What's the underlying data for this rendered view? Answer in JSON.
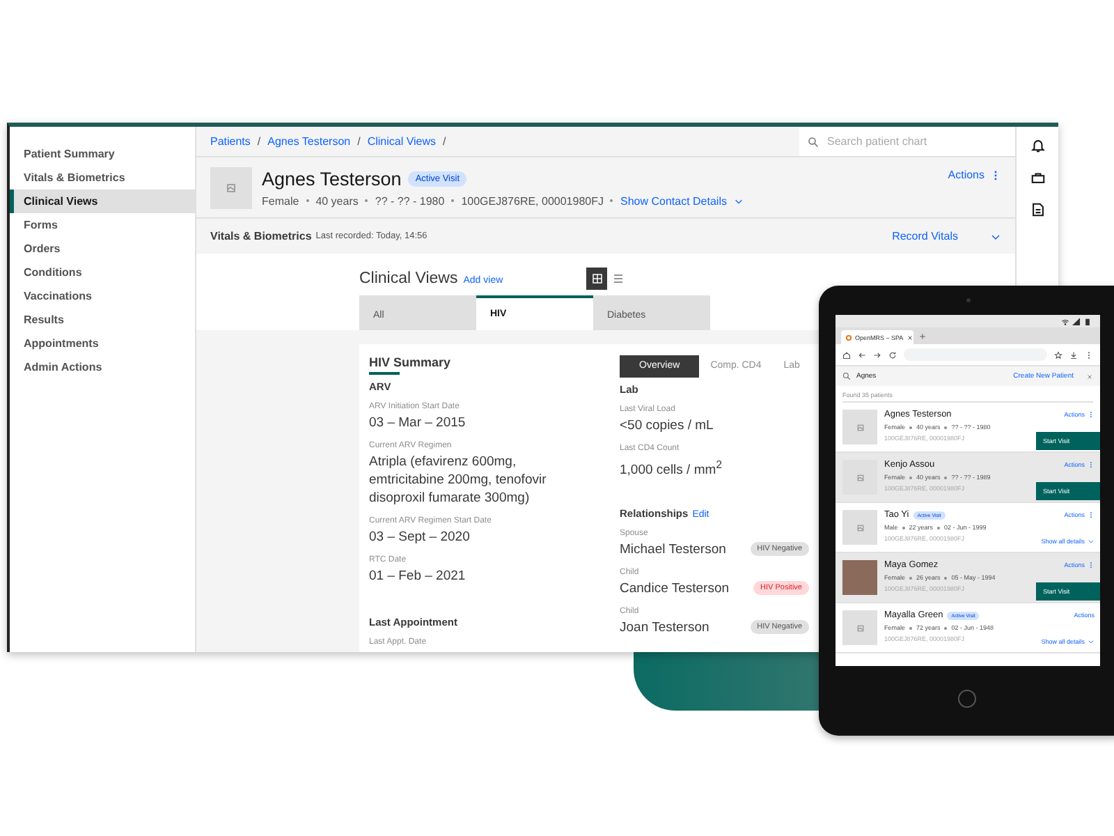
{
  "desktop": {
    "sidebar": {
      "items": [
        {
          "label": "Patient Summary",
          "selected": false
        },
        {
          "label": "Vitals & Biometrics",
          "selected": false
        },
        {
          "label": "Clinical Views",
          "selected": true
        },
        {
          "label": "Forms",
          "selected": false
        },
        {
          "label": "Orders",
          "selected": false
        },
        {
          "label": "Conditions",
          "selected": false
        },
        {
          "label": "Vaccinations",
          "selected": false
        },
        {
          "label": "Results",
          "selected": false
        },
        {
          "label": "Appointments",
          "selected": false
        },
        {
          "label": "Admin Actions",
          "selected": false
        }
      ]
    },
    "breadcrumbs": {
      "separator": "/",
      "items": [
        "Patients",
        "Agnes Testerson",
        "Clinical Views"
      ]
    },
    "search": {
      "placeholder": "Search patient chart"
    },
    "patient": {
      "name": "Agnes Testerson",
      "badge": "Active Visit",
      "details": [
        "Female",
        "40 years",
        "?? - ?? - 1980",
        "100GEJ876RE, 00001980FJ"
      ],
      "contact_link": "Show Contact Details",
      "actions": "Actions"
    },
    "vitals": {
      "title": "Vitals & Biometrics",
      "last_recorded": "Last recorded: Today, 14:56",
      "action": "Record Vitals"
    },
    "clinical_views": {
      "title": "Clinical Views",
      "add_link": "Add view",
      "view_toggles": [
        {
          "kind": "grid",
          "selected": true
        },
        {
          "kind": "list",
          "selected": false
        }
      ],
      "tabs": [
        {
          "label": "All",
          "selected": false
        },
        {
          "label": "HIV",
          "selected": true
        },
        {
          "label": "Diabetes",
          "selected": false
        }
      ],
      "summary": {
        "title": "HIV Summary",
        "sections": [
          {
            "heading": "ARV",
            "fields": [
              {
                "label": "ARV Initiation Start Date",
                "value": "03 – Mar – 2015"
              },
              {
                "label": "Current ARV Regimen",
                "value": "Atripla (efavirenz 600mg, emtricitabine 200mg, tenofovir disoproxil fumarate 300mg)"
              },
              {
                "label": "Current ARV Regimen Start Date",
                "value": "03 – Sept – 2020"
              },
              {
                "label": "RTC Date",
                "value": "01 – Feb – 2021"
              }
            ]
          },
          {
            "heading": "Last Appointment",
            "fields": [
              {
                "label": "Last Appt. Date"
              }
            ]
          }
        ]
      },
      "side_tabs": [
        {
          "label": "Overview",
          "selected": true
        },
        {
          "label": "Comp. CD4",
          "selected": false
        },
        {
          "label": "Lab",
          "selected": false
        }
      ],
      "lab": {
        "heading": "Lab",
        "fields": [
          {
            "label": "Last Viral Load",
            "value": "<50 copies / mL"
          },
          {
            "label": "Last CD4 Count",
            "value": "1,000 cells / mm$^{2}$"
          }
        ]
      },
      "relationships": {
        "heading": "Relationships",
        "edit": "Edit",
        "people": [
          {
            "relation": "Spouse",
            "name": "Michael Testerson",
            "status": "HIV Negative",
            "kind": "negative"
          },
          {
            "relation": "Child",
            "name": "Candice Testerson",
            "status": "HIV Positive",
            "kind": "positive"
          },
          {
            "relation": "Child",
            "name": "Joan Testerson",
            "status": "HIV Negative",
            "kind": "negative"
          }
        ]
      }
    }
  },
  "tablet": {
    "browser_tab": "OpenMRS – SPA",
    "search": {
      "value": "Agnes"
    },
    "create_link": "Create New Patient",
    "found": "Found 35 patients",
    "patients": [
      {
        "name": "Agnes Testerson",
        "details": [
          "Female",
          "40 years",
          "?? - ?? - 1980"
        ],
        "ids": "100GEJ876RE, 00001980FJ",
        "actions": "Actions",
        "menu_icon": true,
        "photo": false,
        "highlighted": false,
        "action": {
          "kind": "button",
          "label": "Start Visit"
        }
      },
      {
        "name": "Kenjo Assou",
        "details": [
          "Female",
          "40 years",
          "?? - ?? - 1989"
        ],
        "ids": "100GEJ876RE, 00001980FJ",
        "actions": "Actions",
        "menu_icon": true,
        "photo": false,
        "highlighted": true,
        "action": {
          "kind": "button",
          "label": "Start Visit"
        }
      },
      {
        "name": "Tao Yi",
        "badge": "Active Visit",
        "details": [
          "Male",
          "22 years",
          "02 - Jun - 1999"
        ],
        "ids": "100GEJ876RE, 00001980FJ",
        "actions": "Actions",
        "menu_icon": true,
        "photo": false,
        "highlighted": false,
        "action": {
          "kind": "link",
          "label": "Show all details"
        }
      },
      {
        "name": "Maya Gomez",
        "details": [
          "Female",
          "26 years",
          "05 - May - 1994"
        ],
        "ids": "100GEJ876RE, 00001980FJ",
        "actions": "Actions",
        "menu_icon": true,
        "photo": true,
        "highlighted": true,
        "action": {
          "kind": "button",
          "label": "Start Visit"
        }
      },
      {
        "name": "Mayalla Green",
        "badge": "Active Visit",
        "details": [
          "Female",
          "72 years",
          "02 - Jun - 1948"
        ],
        "ids": "100GEJ876RE, 00001980FJ",
        "actions": "Actions",
        "menu_icon": false,
        "photo": false,
        "highlighted": false,
        "action": {
          "kind": "link",
          "label": "Show all details"
        }
      }
    ]
  }
}
